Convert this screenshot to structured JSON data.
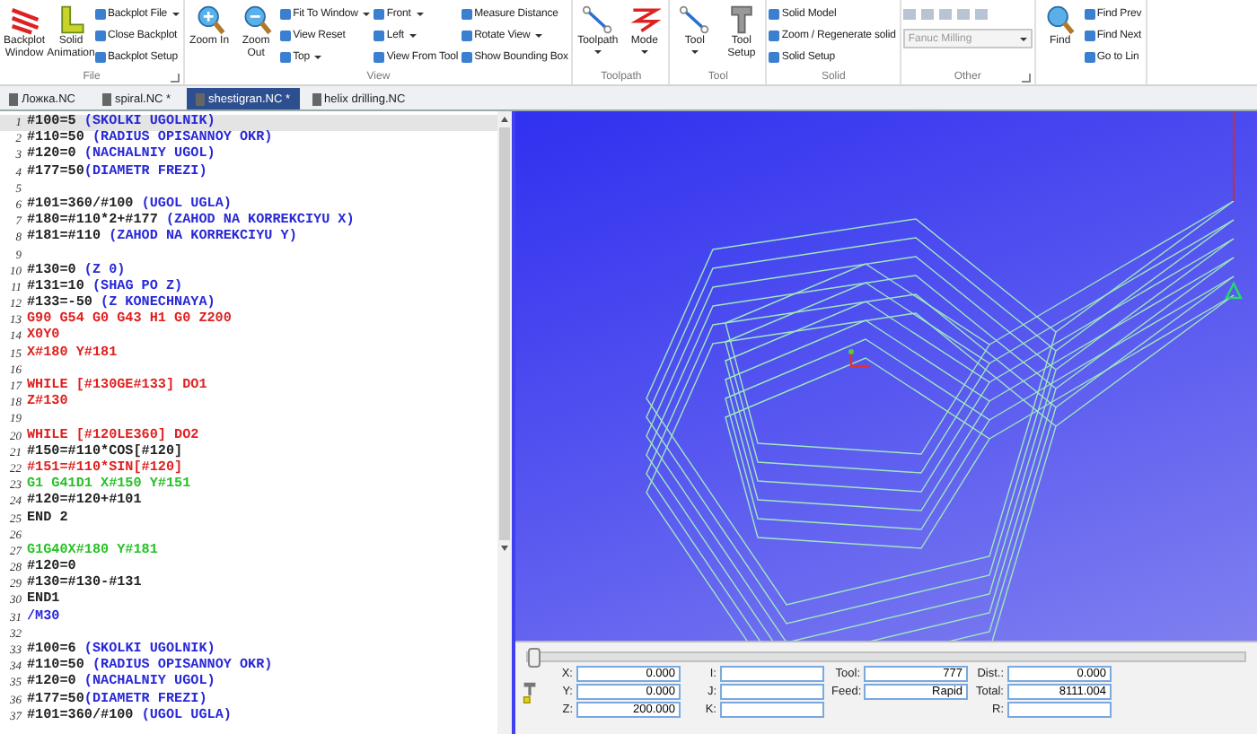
{
  "ribbon": {
    "groups": [
      {
        "label": "File",
        "launcher": true,
        "large": [
          {
            "label": "Backplot Window",
            "dropdown": false
          },
          {
            "label": "Solid Animation",
            "dropdown": false
          }
        ],
        "small": [
          {
            "label": "Backplot File",
            "dropdown": true
          },
          {
            "label": "Close Backplot",
            "dropdown": false
          },
          {
            "label": "Backplot Setup",
            "dropdown": false
          }
        ]
      },
      {
        "label": "View",
        "launcher": false,
        "large": [
          {
            "label": "Zoom In",
            "dropdown": false
          },
          {
            "label": "Zoom Out",
            "dropdown": false
          }
        ],
        "small": [
          {
            "label": "Fit To Window",
            "dropdown": true
          },
          {
            "label": "View Reset",
            "dropdown": false
          },
          {
            "label": "Top",
            "dropdown": true
          },
          {
            "label": "Front",
            "dropdown": true
          },
          {
            "label": "Left",
            "dropdown": true
          },
          {
            "label": "View From Tool",
            "dropdown": false
          },
          {
            "label": "Measure Distance",
            "dropdown": false
          },
          {
            "label": "Rotate View",
            "dropdown": true
          },
          {
            "label": "Show Bounding Box",
            "dropdown": false
          }
        ]
      },
      {
        "label": "Toolpath",
        "launcher": false,
        "large": [
          {
            "label": "Toolpath",
            "dropdown": true
          },
          {
            "label": "Mode",
            "dropdown": true
          }
        ]
      },
      {
        "label": "Tool",
        "launcher": false,
        "large": [
          {
            "label": "Tool",
            "dropdown": true
          },
          {
            "label": "Tool Setup",
            "dropdown": false
          }
        ]
      },
      {
        "label": "Solid",
        "launcher": false,
        "small": [
          {
            "label": "Solid Model",
            "dropdown": false
          },
          {
            "label": "Zoom / Regenerate solid",
            "dropdown": false
          },
          {
            "label": "Solid Setup",
            "dropdown": false
          }
        ]
      },
      {
        "label": "Other",
        "launcher": true,
        "select": {
          "value": "Fanuc Milling",
          "disabled": true
        }
      },
      {
        "launcher": false,
        "large": [
          {
            "label": "Find",
            "dropdown": false
          }
        ],
        "small": [
          {
            "label": "Find Prev",
            "dropdown": false
          },
          {
            "label": "Find Next",
            "dropdown": false
          },
          {
            "label": "Go to Lin",
            "dropdown": false
          }
        ]
      }
    ]
  },
  "tabs": [
    {
      "label": "Ложка.NC",
      "selected": false
    },
    {
      "label": "spiral.NC *",
      "selected": false
    },
    {
      "label": "shestigran.NC *",
      "selected": true
    },
    {
      "label": "helix drilling.NC",
      "selected": false
    }
  ],
  "editor": {
    "lines": [
      {
        "number": "1",
        "selected": true,
        "parts": [
          {
            "kind": "code",
            "text": "#100=5 "
          },
          {
            "kind": "comment",
            "text": "(SKOLKI UGOLNIK)"
          }
        ]
      },
      {
        "number": "2",
        "selected": false,
        "parts": [
          {
            "kind": "code",
            "text": "#110=50 "
          },
          {
            "kind": "comment",
            "text": "(RADIUS OPISANNOY OKR)"
          }
        ]
      },
      {
        "number": "3",
        "selected": false,
        "parts": [
          {
            "kind": "code",
            "text": "#120=0 "
          },
          {
            "kind": "comment",
            "text": "(NACHALNIY UGOL)"
          }
        ]
      },
      {
        "number": "4",
        "selected": false,
        "parts": [
          {
            "kind": "code",
            "text": "#177=50"
          },
          {
            "kind": "comment",
            "text": "(DIAMETR FREZI)"
          }
        ]
      },
      {
        "number": "5",
        "selected": false
      },
      {
        "number": "6",
        "selected": false,
        "parts": [
          {
            "kind": "code",
            "text": "#101=360/#100 "
          },
          {
            "kind": "comment",
            "text": "(UGOL UGLA)"
          }
        ]
      },
      {
        "number": "7",
        "selected": false,
        "parts": [
          {
            "kind": "code",
            "text": "#180=#110*2+#177 "
          },
          {
            "kind": "comment",
            "text": "(ZAHOD NA KORREKCIYU X)"
          }
        ]
      },
      {
        "number": "8",
        "selected": false,
        "parts": [
          {
            "kind": "code",
            "text": "#181=#110 "
          },
          {
            "kind": "comment",
            "text": "(ZAHOD NA KORREKCIYU Y)"
          }
        ]
      },
      {
        "number": "9",
        "selected": false
      },
      {
        "number": "10",
        "selected": false,
        "parts": [
          {
            "kind": "code",
            "text": "#130=0 "
          },
          {
            "kind": "comment",
            "text": "(Z 0)"
          }
        ]
      },
      {
        "number": "11",
        "selected": false,
        "parts": [
          {
            "kind": "code",
            "text": "#131=10 "
          },
          {
            "kind": "comment",
            "text": "(SHAG PO Z)"
          }
        ]
      },
      {
        "number": "12",
        "selected": false,
        "parts": [
          {
            "kind": "code",
            "text": "#133=-50 "
          },
          {
            "kind": "comment",
            "text": "(Z KONECHNAYA)"
          }
        ]
      },
      {
        "number": "13",
        "selected": false,
        "parts": [
          {
            "kind": "macro",
            "text": "G90 G54 G0 G43 H1 G0 Z200"
          }
        ]
      },
      {
        "number": "14",
        "selected": false,
        "parts": [
          {
            "kind": "macro",
            "text": "X0Y0"
          }
        ]
      },
      {
        "number": "15",
        "selected": false,
        "parts": [
          {
            "kind": "macro",
            "text": "X#180 Y#181"
          }
        ]
      },
      {
        "number": "16",
        "selected": false
      },
      {
        "number": "17",
        "selected": false,
        "parts": [
          {
            "kind": "macro",
            "text": "WHILE [#130GE#133] DO1"
          }
        ]
      },
      {
        "number": "18",
        "selected": false,
        "parts": [
          {
            "kind": "macro",
            "text": "Z#130"
          }
        ]
      },
      {
        "number": "19",
        "selected": false
      },
      {
        "number": "20",
        "selected": false,
        "parts": [
          {
            "kind": "macro",
            "text": "WHILE [#120LE360] DO2"
          }
        ]
      },
      {
        "number": "21",
        "selected": false,
        "parts": [
          {
            "kind": "code",
            "text": "#150=#110*COS[#120]"
          }
        ]
      },
      {
        "number": "22",
        "selected": false,
        "parts": [
          {
            "kind": "macro",
            "text": "#151=#110*SIN[#120]"
          }
        ]
      },
      {
        "number": "23",
        "selected": false,
        "parts": [
          {
            "kind": "motion",
            "text": "G1 G41D1 X#150 Y#151"
          }
        ]
      },
      {
        "number": "24",
        "selected": false,
        "parts": [
          {
            "kind": "code",
            "text": "#120=#120+#101"
          }
        ]
      },
      {
        "number": "25",
        "selected": false,
        "parts": [
          {
            "kind": "code",
            "text": "END 2"
          }
        ]
      },
      {
        "number": "26",
        "selected": false
      },
      {
        "number": "27",
        "selected": false,
        "parts": [
          {
            "kind": "motion",
            "text": "G1G40X#180 Y#181"
          }
        ]
      },
      {
        "number": "28",
        "selected": false,
        "parts": [
          {
            "kind": "code",
            "text": "#120=0"
          }
        ]
      },
      {
        "number": "29",
        "selected": false,
        "parts": [
          {
            "kind": "code",
            "text": "#130=#130-#131"
          }
        ]
      },
      {
        "number": "30",
        "selected": false,
        "parts": [
          {
            "kind": "code",
            "text": "END1"
          }
        ]
      },
      {
        "number": "31",
        "selected": false,
        "parts": [
          {
            "kind": "skip",
            "text": "/M30"
          }
        ]
      },
      {
        "number": "32",
        "selected": false
      },
      {
        "number": "33",
        "selected": false,
        "parts": [
          {
            "kind": "code",
            "text": "#100=6 "
          },
          {
            "kind": "comment",
            "text": "(SKOLKI UGOLNIK)"
          }
        ]
      },
      {
        "number": "34",
        "selected": false,
        "parts": [
          {
            "kind": "code",
            "text": "#110=50 "
          },
          {
            "kind": "comment",
            "text": "(RADIUS OPISANNOY OKR)"
          }
        ]
      },
      {
        "number": "35",
        "selected": false,
        "parts": [
          {
            "kind": "code",
            "text": "#120=0 "
          },
          {
            "kind": "comment",
            "text": "(NACHALNIY UGOL)"
          }
        ]
      },
      {
        "number": "36",
        "selected": false,
        "parts": [
          {
            "kind": "code",
            "text": "#177=50"
          },
          {
            "kind": "comment",
            "text": "(DIAMETR FREZI)"
          }
        ]
      },
      {
        "number": "37",
        "selected": false,
        "parts": [
          {
            "kind": "code",
            "text": "#101=360/#100 "
          },
          {
            "kind": "comment",
            "text": "(UGOL UGLA)"
          }
        ]
      }
    ]
  },
  "playback": {
    "level": 0
  },
  "readout": {
    "columns": [
      [
        {
          "label": "X:",
          "value": "0.000"
        },
        {
          "label": "Y:",
          "value": "0.000"
        },
        {
          "label": "Z:",
          "value": "200.000"
        }
      ],
      [
        {
          "label": "I:"
        },
        {
          "label": "J:"
        },
        {
          "label": "K:"
        }
      ],
      [
        {
          "label": "Tool:",
          "value": "777"
        },
        {
          "label": "Feed:",
          "value": "Rapid"
        }
      ],
      [
        {
          "label": "Dist.:",
          "value": "0.000"
        },
        {
          "label": "Total:",
          "value": "8111.004"
        },
        {
          "label": "R:"
        }
      ]
    ]
  }
}
